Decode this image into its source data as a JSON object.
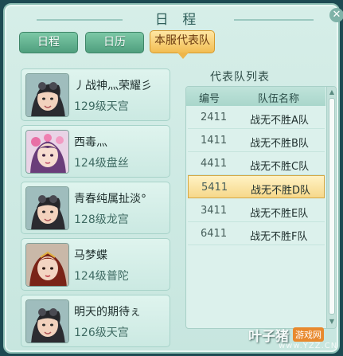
{
  "window": {
    "title": "日 程",
    "close_symbol": "✕"
  },
  "tabs": [
    {
      "label": "日程",
      "active": false
    },
    {
      "label": "日历",
      "active": false
    },
    {
      "label": "本服代表队",
      "active": true
    }
  ],
  "members": [
    {
      "name": "丿战神灬荣耀彡",
      "info": "129级天宫",
      "avatar": "male-hero-avatar"
    },
    {
      "name": "西毒灬",
      "info": "124级盘丝",
      "avatar": "female-flower-avatar"
    },
    {
      "name": "青春纯属扯淡°",
      "info": "128级龙宫",
      "avatar": "male-hero-avatar"
    },
    {
      "name": "马梦蝶",
      "info": "124级普陀",
      "avatar": "female-warrior-avatar"
    },
    {
      "name": "明天的期待ぇ",
      "info": "126级天宫",
      "avatar": "male-hero-avatar"
    }
  ],
  "team_list": {
    "title": "代表队列表",
    "headers": {
      "num": "编号",
      "team": "队伍名称"
    },
    "rows": [
      {
        "num": "2411",
        "team": "战无不胜A队",
        "selected": false
      },
      {
        "num": "1411",
        "team": "战无不胜B队",
        "selected": false
      },
      {
        "num": "4411",
        "team": "战无不胜C队",
        "selected": false
      },
      {
        "num": "5411",
        "team": "战无不胜D队",
        "selected": true
      },
      {
        "num": "3411",
        "team": "战无不胜E队",
        "selected": false
      },
      {
        "num": "6411",
        "team": "战无不胜F队",
        "selected": false
      }
    ]
  },
  "scrollbar": {
    "up_symbol": "▲",
    "down_symbol": "▼"
  },
  "watermark": {
    "main": "叶子猪",
    "tag": "游戏网",
    "url": "www.YZZ.CN"
  }
}
